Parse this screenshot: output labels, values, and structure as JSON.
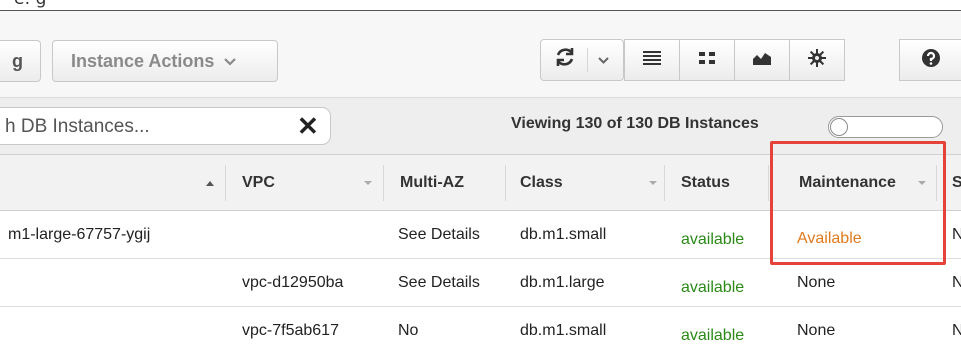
{
  "top_fragment": "e: g",
  "toolbar": {
    "left_button_label": "g",
    "instance_actions_label": "Instance Actions",
    "refresh_icon": "refresh-icon",
    "icons": [
      "list-icon",
      "grid-icon",
      "chart-icon",
      "gear-icon",
      "help-icon"
    ]
  },
  "filter": {
    "search_value": "h DB Instances...",
    "clear_symbol": "✕",
    "viewing_text": "Viewing 130 of 130 DB Instances"
  },
  "table": {
    "columns": [
      "VPC",
      "Multi-AZ",
      "Class",
      "Status",
      "Maintenance",
      "S"
    ],
    "rows": [
      {
        "name": "m1-large-67757-ygij",
        "vpc": "",
        "multi_az": "See Details",
        "class": "db.m1.small",
        "status": "available",
        "maintenance": "Available",
        "extra": "N"
      },
      {
        "name": "",
        "vpc": "vpc-d12950ba",
        "multi_az": "See Details",
        "class": "db.m1.large",
        "status": "available",
        "maintenance": "None",
        "extra": "N"
      },
      {
        "name": "",
        "vpc": "vpc-7f5ab617",
        "multi_az": "No",
        "class": "db.m1.small",
        "status": "available",
        "maintenance": "None",
        "extra": "N"
      }
    ]
  },
  "colors": {
    "status_available": "#2a8a17",
    "maintenance_available": "#e07a1e",
    "highlight_border": "#e5433a"
  }
}
